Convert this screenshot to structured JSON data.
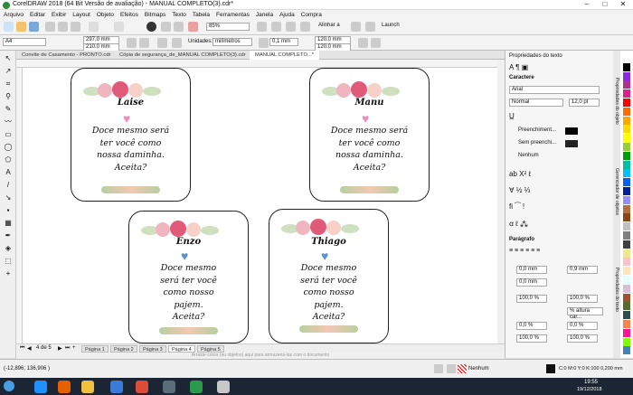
{
  "title_bar": {
    "title": "CorelDRAW 2018 (64 Bit Versão de avaliação) - MANUAL COMPLETO(3).cdr*"
  },
  "menu": [
    "Arquivo",
    "Editar",
    "Exibir",
    "Layout",
    "Objeto",
    "Efeitos",
    "Bitmaps",
    "Texto",
    "Tabela",
    "Ferramentas",
    "Janela",
    "Ajuda",
    "Compra"
  ],
  "toolbar": {
    "zoom": "85%",
    "snap": "Alinhar a",
    "launch": "Launch"
  },
  "propbar": {
    "page_size": "A4",
    "width": "297,0 mm",
    "height": "210,0 mm",
    "units_label": "Unidades:",
    "units": "milímetros",
    "nudge": "0,1 mm",
    "dup_x": "120,0 mm",
    "dup_y": "120,0 mm"
  },
  "doc_tabs": [
    {
      "label": "Convite de Casamento - PRONTO.cdr",
      "active": false
    },
    {
      "label": "Cópia de segurança_de_MANUAL COMPLETO(3).cdr",
      "active": false
    },
    {
      "label": "MANUAL COMPLETO...*",
      "active": true
    }
  ],
  "cards": [
    {
      "name": "Laise",
      "heart": "#f08cc0",
      "lines": [
        "Doce mesmo será",
        "ter você como",
        "nossa daminha.",
        "Aceita?"
      ]
    },
    {
      "name": "Manu",
      "heart": "#f08cc0",
      "lines": [
        "Doce mesmo será",
        "ter você como",
        "nossa daminha.",
        "Aceita?"
      ]
    },
    {
      "name": "Enzo",
      "heart": "#5b8fd6",
      "lines": [
        "Doce mesmo",
        "será ter você",
        "como nosso",
        "pajem.",
        "Aceita?"
      ]
    },
    {
      "name": "Thiago",
      "heart": "#5b8fd6",
      "lines": [
        "Doce mesmo",
        "será ter você",
        "como nosso",
        "pajem.",
        "Aceita?"
      ]
    }
  ],
  "page_nav": {
    "counter": "4 de 5",
    "pages": [
      "Página 1",
      "Página 2",
      "Página 3",
      "Página 4",
      "Página 5"
    ],
    "active": "Página 4"
  },
  "drop_hint": "Arraste cores (ou objetos) aqui para armazená-las com o documento",
  "panel": {
    "title": "Propriedades do texto",
    "section_char": "Caractere",
    "font": "Arial",
    "style": "Normal",
    "size": "12,0 pt",
    "fill1": "Preenchiment...",
    "fill2": "Sem preenchi...",
    "outline": "Nenhum",
    "section_para": "Parágrafo",
    "indent1": "0,0 mm",
    "indent2": "0,9 mm",
    "indent3": "0,0 mm",
    "spacing1": "100,0 %",
    "spacing2": "100,0 %",
    "spacing3": "% altura car...",
    "spacing4": "0,0 %",
    "spacing5": "0,0 %",
    "spacing6": "100,0 %",
    "spacing7": "100,0 %"
  },
  "right_tabs": [
    "Propriedades do objeto",
    "Gerenciador de objetos",
    "Propriedades do texto"
  ],
  "palette": [
    "#ffffff",
    "#000000",
    "#8a2be2",
    "#b03090",
    "#e0208a",
    "#ff0000",
    "#ff6a00",
    "#ffa500",
    "#ffd700",
    "#ffff00",
    "#9acd32",
    "#00a000",
    "#00c0a0",
    "#00bfff",
    "#0060ff",
    "#0020a0",
    "#9090ff",
    "#b07040",
    "#8b4513",
    "#c0c0c0",
    "#808080",
    "#404040",
    "#f0e68c",
    "#ffc0cb",
    "#ffe4b5",
    "#e0ffff",
    "#d8bfd8",
    "#a0522d",
    "#556b2f",
    "#2f4f4f",
    "#ff7f50",
    "#ff1493",
    "#7fff00",
    "#4682b4"
  ],
  "status": {
    "coords": "(-12,896; 136,906 )",
    "fill_label": "Nenhum",
    "color_info": "C:0 M:0 Y:0 K:100  0,200 mm"
  },
  "taskbar": {
    "time": "19:55",
    "date": "19/12/2018"
  }
}
